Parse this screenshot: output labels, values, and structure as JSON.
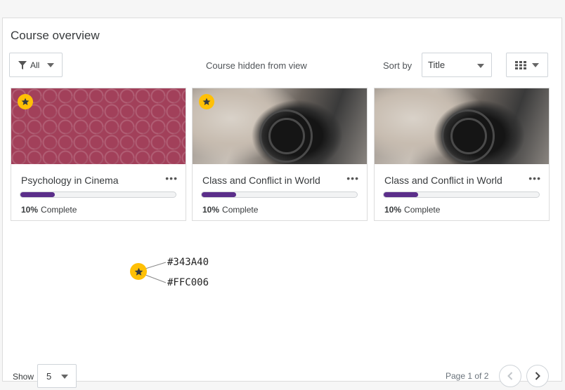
{
  "header": {
    "title": "Course overview"
  },
  "toolbar": {
    "filter_label": "All",
    "hidden_text": "Course hidden from view",
    "sort_label": "Sort by",
    "sort_value": "Title"
  },
  "courses": [
    {
      "name": "Psychology in Cinema",
      "progress_percent": 10,
      "progress_text": "10%",
      "complete_label": "Complete",
      "starred": true,
      "image": "pattern"
    },
    {
      "name": "Class and Conflict in World",
      "progress_percent": 10,
      "progress_text": "10%",
      "complete_label": "Complete",
      "starred": true,
      "image": "camera"
    },
    {
      "name": "Class and Conflict in World",
      "progress_percent": 10,
      "progress_text": "10%",
      "complete_label": "Complete",
      "starred": false,
      "image": "camera"
    }
  ],
  "legend": {
    "icon_color_label": "#343A40",
    "badge_color_label": "#FFC006"
  },
  "footer": {
    "show_label": "Show",
    "show_value": "5",
    "page_text": "Page 1 of 2"
  },
  "colors": {
    "star_icon": "#343A40",
    "star_badge": "#FFC006",
    "progress": "#5B2E8A"
  },
  "icons": {
    "filter": "funnel-icon",
    "caret": "caret-down-icon",
    "view": "grid-view-icon",
    "menu": "more-dots-icon",
    "star": "star-icon",
    "prev": "chevron-left-icon",
    "next": "chevron-right-icon"
  }
}
